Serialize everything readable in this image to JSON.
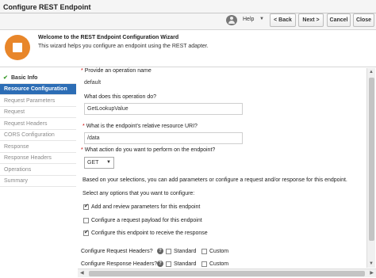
{
  "header": {
    "title": "Configure REST Endpoint",
    "help_label": "Help",
    "back_label": "< Back",
    "next_label": "Next >",
    "cancel_label": "Cancel",
    "close_label": "Close"
  },
  "banner": {
    "title": "Welcome to the REST Endpoint Configuration Wizard",
    "text": "This wizard helps you configure an endpoint using the REST adapter.",
    "icon": "rest-adapter-icon"
  },
  "sidebar": {
    "items": [
      {
        "label": "Basic Info"
      },
      {
        "label": "Resource Configuration"
      },
      {
        "label": "Request Parameters"
      },
      {
        "label": "Request"
      },
      {
        "label": "Request Headers"
      },
      {
        "label": "CORS Configuration"
      },
      {
        "label": "Response"
      },
      {
        "label": "Response Headers"
      },
      {
        "label": "Operations"
      },
      {
        "label": "Summary"
      }
    ]
  },
  "form": {
    "cutoff_label": "Provide an operation name",
    "operation_name": "default",
    "what_label": "What does this operation do?",
    "what_value": "GetLookupValue",
    "uri_label": "What is the endpoint's relative resource URI?",
    "uri_value": "/data",
    "action_label": "What action do you want to perform on the endpoint?",
    "action_value": "GET",
    "info_text": "Based on your selections, you can add parameters or configure a request and/or response for this endpoint.",
    "select_label": "Select any options that you want to configure:",
    "options": [
      {
        "label": "Add and review parameters for this endpoint",
        "checked": true
      },
      {
        "label": "Configure a request payload for this endpoint",
        "checked": false
      },
      {
        "label": "Configure this endpoint to receive the response",
        "checked": true
      }
    ],
    "req_headers_label": "Configure Request Headers?",
    "resp_headers_label": "Configure Response Headers?",
    "standard_label": "Standard",
    "custom_label": "Custom",
    "required_mark": "*"
  },
  "colors": {
    "active_nav": "#2c6db5",
    "brand_orange": "#e8862a",
    "check_green": "#3a9a2a"
  }
}
